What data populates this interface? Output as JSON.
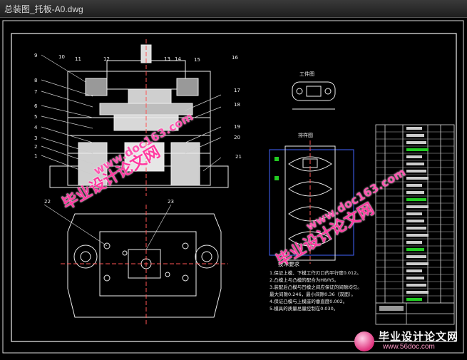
{
  "window": {
    "title": "总装图_托板-A0.dwg"
  },
  "drawing": {
    "part_numbers_left": [
      "9",
      "8",
      "7",
      "6",
      "5",
      "4",
      "3",
      "2",
      "1"
    ],
    "part_numbers_top": [
      "10",
      "11",
      "12",
      "13",
      "14",
      "15",
      "16"
    ],
    "part_numbers_right": [
      "17",
      "18",
      "19",
      "20",
      "21"
    ],
    "label_22": "22",
    "label_23": "23",
    "view_workpiece": "工件图",
    "view_layout": "排样图",
    "notes_title": "技术要求",
    "notes": [
      "1.保证上模、下模工作刃口的平行度0.012。",
      "2.凸模上与凸模的配合为H8/h5。",
      "3.装配后凸模与凹模之间应保证的间隙均匀。",
      "  最大间隙0.246，最小间隙0.36（双面）。",
      "4.保证凸模与上模座的垂直度0.002。",
      "5.模具的质量总量控制在0.030。"
    ]
  },
  "watermarks": {
    "cn": "毕业设计论文网",
    "url": "www.doc163.com"
  },
  "brand": {
    "cn": "毕业设计论文网",
    "url": "www.56doc.com"
  }
}
